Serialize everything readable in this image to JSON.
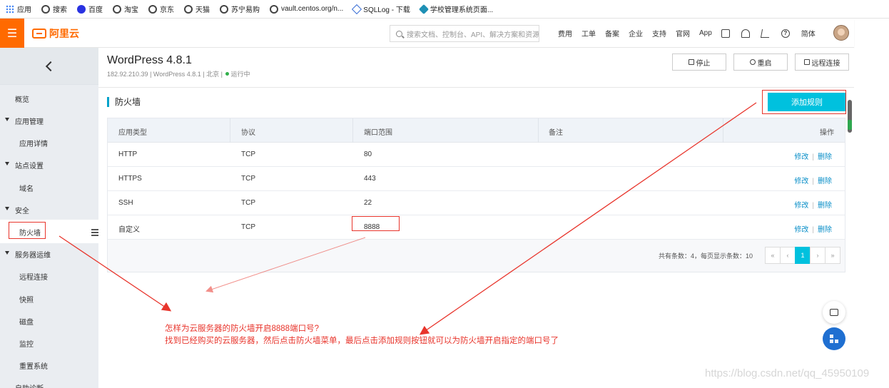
{
  "bookmarks": [
    {
      "label": "应用",
      "icon": "apps-icon"
    },
    {
      "label": "搜索",
      "icon": "globe-icon"
    },
    {
      "label": "百度",
      "icon": "baidu-icon"
    },
    {
      "label": "淘宝",
      "icon": "globe-icon"
    },
    {
      "label": "京东",
      "icon": "globe-icon"
    },
    {
      "label": "天猫",
      "icon": "globe-icon"
    },
    {
      "label": "苏宁易购",
      "icon": "globe-icon"
    },
    {
      "label": "vault.centos.org/n...",
      "icon": "globe-icon"
    },
    {
      "label": "SQLLog - 下载",
      "icon": "sqllog-icon"
    },
    {
      "label": "学校管理系统页面...",
      "icon": "school-icon"
    }
  ],
  "topnav": {
    "logo": "阿里云",
    "search_placeholder": "搜索文档、控制台、API、解决方案和资源",
    "links": [
      "费用",
      "工单",
      "备案",
      "企业",
      "支持",
      "官网",
      "App"
    ],
    "lang": "简体"
  },
  "sidebar": {
    "overview": "概览",
    "app_mgmt": "应用管理",
    "app_detail": "应用详情",
    "site_settings": "站点设置",
    "domain": "域名",
    "security": "安全",
    "firewall": "防火墙",
    "server_ops": "服务器运维",
    "remote": "远程连接",
    "snapshot": "快照",
    "disk": "磁盘",
    "monitor": "监控",
    "reset": "重置系统",
    "diagnose": "自助诊断"
  },
  "instance": {
    "title": "WordPress 4.8.1",
    "ip": "182.92.210.39",
    "image": "WordPress 4.8.1",
    "region": "北京",
    "status": "运行中"
  },
  "actions": {
    "stop": "停止",
    "restart": "重启",
    "remote": "远程连接"
  },
  "firewall": {
    "title": "防火墙",
    "add_rule": "添加规则",
    "columns": [
      "应用类型",
      "协议",
      "端口范围",
      "备注",
      "操作"
    ],
    "rows": [
      {
        "app": "HTTP",
        "protocol": "TCP",
        "port": "80",
        "note": "",
        "edit": "修改",
        "delete": "删除"
      },
      {
        "app": "HTTPS",
        "protocol": "TCP",
        "port": "443",
        "note": "",
        "edit": "修改",
        "delete": "删除"
      },
      {
        "app": "SSH",
        "protocol": "TCP",
        "port": "22",
        "note": "",
        "edit": "修改",
        "delete": "删除"
      },
      {
        "app": "自定义",
        "protocol": "TCP",
        "port": "8888",
        "note": "",
        "edit": "修改",
        "delete": "删除"
      }
    ],
    "pager": {
      "info": "共有条数：4，每页显示条数：10",
      "first": "«",
      "prev": "‹",
      "current": "1",
      "next": "›",
      "last": "»"
    }
  },
  "annotation": {
    "line1": "怎样为云服务器的防火墙开启8888端口号?",
    "line2": "找到已经购买的云服务器，然后点击防火墙菜单，最后点击添加规则按钮就可以为防火墙开启指定的端口号了",
    "color": "#e8352c"
  },
  "watermark": "https://blog.csdn.net/qq_45950109",
  "colors": {
    "brand": "#ff6a00",
    "accent": "#00c1de",
    "link": "#0a8fc8",
    "running": "#31b04b"
  }
}
